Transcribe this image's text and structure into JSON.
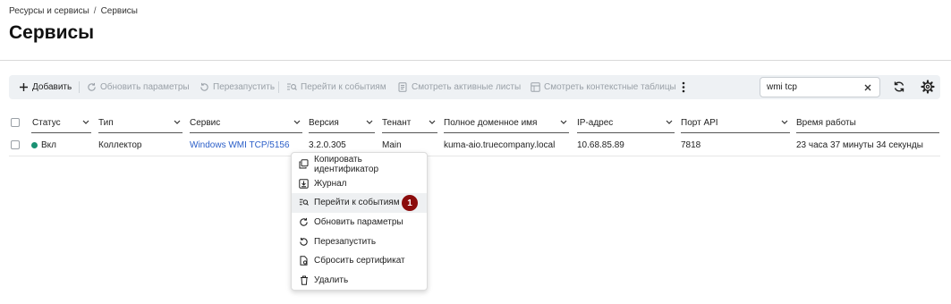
{
  "breadcrumb": {
    "parent": "Ресурсы и сервисы",
    "separator": "/",
    "current": "Сервисы"
  },
  "page_title": "Сервисы",
  "toolbar": {
    "add": "Добавить",
    "update_params": "Обновить параметры",
    "restart": "Перезапустить",
    "go_to_events": "Перейти к событиям",
    "view_active_lists": "Смотреть активные листы",
    "view_context_tables": "Смотреть контекстные таблицы"
  },
  "search": {
    "value": "wmi tcp"
  },
  "table": {
    "headers": {
      "status": "Статус",
      "type": "Тип",
      "service": "Сервис",
      "version": "Версия",
      "tenant": "Тенант",
      "fqdn": "Полное доменное имя",
      "ip": "IP-адрес",
      "api_port": "Порт API",
      "uptime": "Время работы"
    },
    "rows": [
      {
        "status": "Вкл",
        "type": "Коллектор",
        "service": "Windows WMI TCP/5156",
        "version": "3.2.0.305",
        "tenant": "Main",
        "fqdn": "kuma-aio.truecompany.local",
        "ip": "10.68.85.89",
        "api_port": "7818",
        "uptime": "23 часа 37 минуты 34 секунды"
      }
    ]
  },
  "context_menu": {
    "items": [
      {
        "label": "Копировать идентификатор",
        "icon": "copy-icon"
      },
      {
        "label": "Журнал",
        "icon": "download-icon"
      },
      {
        "label": "Перейти к событиям",
        "icon": "events-icon",
        "highlighted": true
      },
      {
        "label": "Обновить параметры",
        "icon": "refresh-icon"
      },
      {
        "label": "Перезапустить",
        "icon": "restart-icon"
      },
      {
        "label": "Сбросить сертификат",
        "icon": "certificate-icon"
      },
      {
        "label": "Удалить",
        "icon": "trash-icon"
      }
    ],
    "callout": "1"
  },
  "colors": {
    "status_on": "#1a9173",
    "link": "#2a5ec8",
    "callout": "#8b0c0c",
    "toolbar_bg": "#eef1f4"
  }
}
